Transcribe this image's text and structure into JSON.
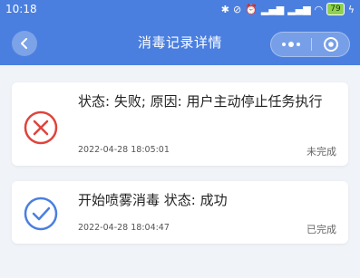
{
  "statusbar": {
    "time": "10:18",
    "battery": "79"
  },
  "navbar": {
    "title": "消毒记录详情"
  },
  "records": [
    {
      "icon": "fail-x-icon",
      "title": "状态: 失败; 原因: 用户主动停止任务执行",
      "time": "2022-04-28 18:05:01",
      "state": "未完成",
      "color": "#e0433c"
    },
    {
      "icon": "success-check-icon",
      "title": "开始喷雾消毒 状态: 成功",
      "time": "2022-04-28 18:04:47",
      "state": "已完成",
      "color": "#4a7fe0"
    }
  ],
  "colors": {
    "primary": "#4a7fe0",
    "background": "#f0f3f8",
    "error": "#e0433c"
  }
}
